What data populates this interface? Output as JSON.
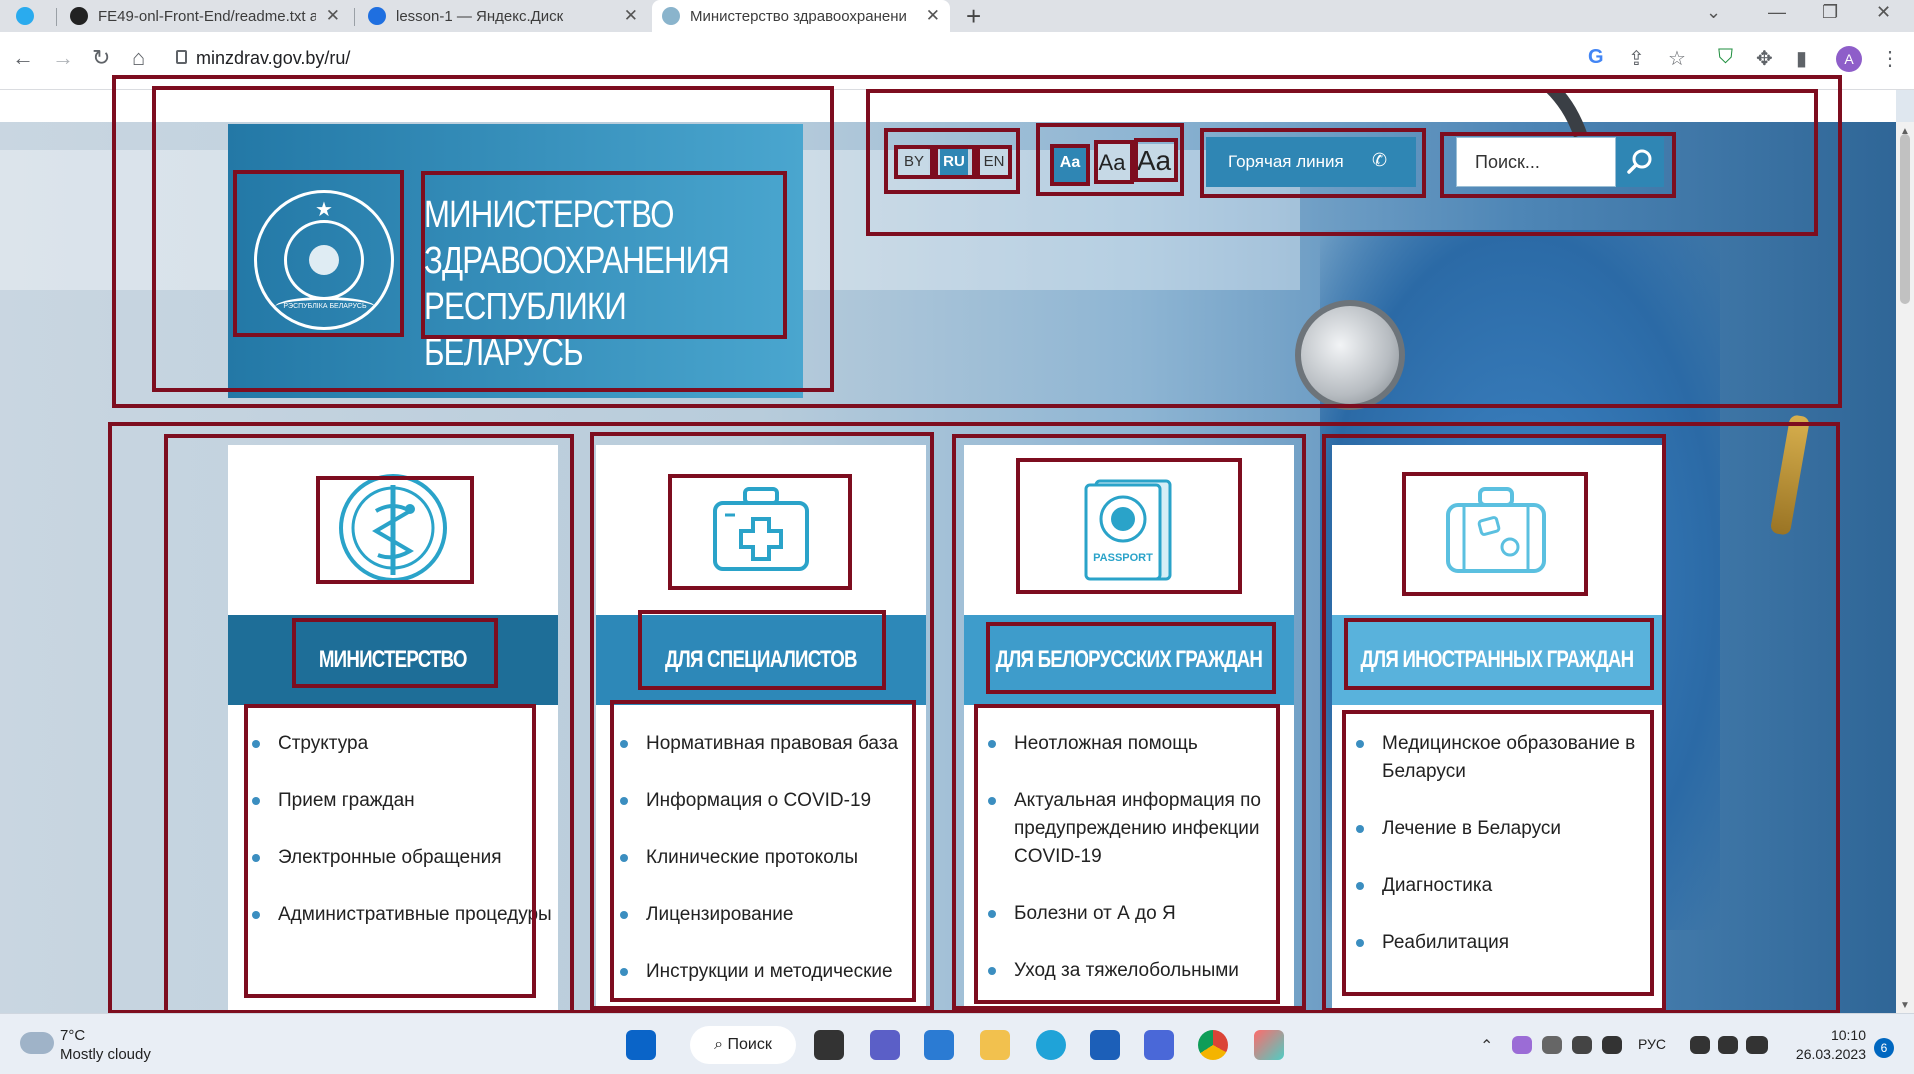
{
  "browser": {
    "tabs": [
      {
        "title": "",
        "icon": "telegram-icon",
        "color": "#2aabee"
      },
      {
        "title": "FE49-onl-Front-End/readme.txt a",
        "icon": "github-icon",
        "color": "#222222"
      },
      {
        "title": "lesson-1 — Яндекс.Диск",
        "icon": "yandex-disk-icon",
        "color": "#1f6fe0"
      },
      {
        "title": "Министерство здравоохранени",
        "icon": "globe-icon",
        "color": "#8ab4cc"
      }
    ],
    "url": "minzdrav.gov.by/ru/",
    "profile_initial": "A"
  },
  "site": {
    "logo_title_lines": [
      "МИНИСТЕРСТВО",
      "ЗДРАВООХРАНЕНИЯ",
      "РЕСПУБЛИКИ БЕЛАРУСЬ"
    ],
    "emblem_text": "РЭСПУБЛІКА БЕЛАРУСЬ",
    "languages": [
      "BY",
      "RU",
      "EN"
    ],
    "active_language": "RU",
    "font_sizes": [
      "Aa",
      "Aa",
      "Aa"
    ],
    "hotline_label": "Горячая линия",
    "search_placeholder": "Поиск...",
    "accent_color": "#2f86b4",
    "highlight_color": "#7d0d1f"
  },
  "cards": [
    {
      "title": "МИНИСТЕРСТВО",
      "icon": "medical-caduceus-icon",
      "band_color": "#1e6e98",
      "items": [
        "Структура",
        "Прием граждан",
        "Электронные обращения",
        "Административные процедуры"
      ]
    },
    {
      "title": "ДЛЯ СПЕЦИАЛИСТОВ",
      "icon": "first-aid-kit-icon",
      "band_color": "#2d88b8",
      "items": [
        "Нормативная правовая база",
        "Информация о COVID-19",
        "Клинические протоколы",
        "Лицензирование",
        "Инструкции и методические"
      ]
    },
    {
      "title": "ДЛЯ БЕЛОРУССКИХ ГРАЖДАН",
      "icon": "passport-icon",
      "band_color": "#3e9ccb",
      "passport_text": "PASSPORT",
      "items": [
        "Неотложная помощь",
        "Актуальная информация по предупреждению инфекции COVID-19",
        "Болезни от А до Я",
        "Уход за тяжелобольными"
      ]
    },
    {
      "title": "ДЛЯ ИНОСТРАННЫХ ГРАЖДАН",
      "icon": "suitcase-icon",
      "band_color": "#59b2dc",
      "items": [
        "Медицинское образование в Беларуси",
        "Лечение в Беларуси",
        "Диагностика",
        "Реабилитация"
      ]
    }
  ],
  "taskbar": {
    "temperature": "7°C",
    "weather": "Mostly cloudy",
    "search_label": "Поиск",
    "input_language": "РУС",
    "time": "10:10",
    "date": "26.03.2023",
    "notifications": "6"
  }
}
